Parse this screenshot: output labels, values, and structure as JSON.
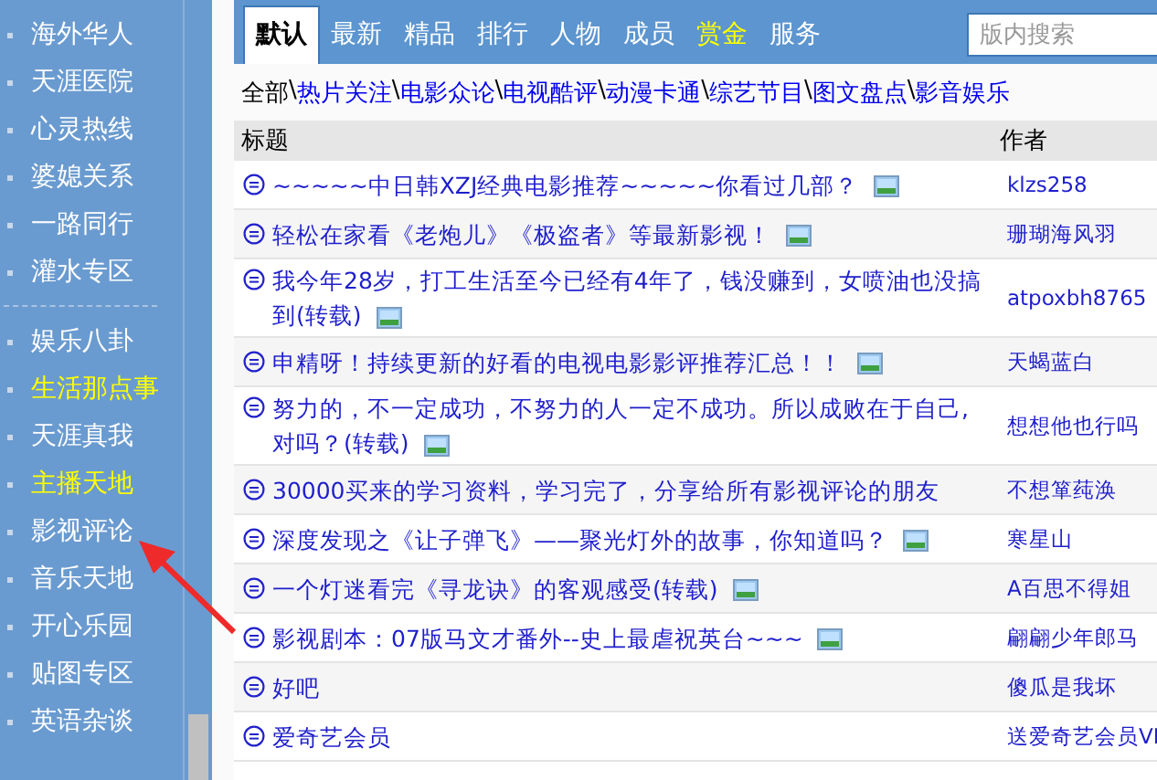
{
  "sidebar": {
    "groups": [
      {
        "items": [
          {
            "label": "海外华人",
            "highlighted": false
          },
          {
            "label": "天涯医院",
            "highlighted": false
          },
          {
            "label": "心灵热线",
            "highlighted": false
          },
          {
            "label": "婆媳关系",
            "highlighted": false
          },
          {
            "label": "一路同行",
            "highlighted": false
          },
          {
            "label": "灌水专区",
            "highlighted": false
          }
        ]
      },
      {
        "items": [
          {
            "label": "娱乐八卦",
            "highlighted": false
          },
          {
            "label": "生活那点事",
            "highlighted": true
          },
          {
            "label": "天涯真我",
            "highlighted": false
          },
          {
            "label": "主播天地",
            "highlighted": true
          },
          {
            "label": "影视评论",
            "highlighted": false
          },
          {
            "label": "音乐天地",
            "highlighted": false
          },
          {
            "label": "开心乐园",
            "highlighted": false
          },
          {
            "label": "贴图专区",
            "highlighted": false
          },
          {
            "label": "英语杂谈",
            "highlighted": false
          }
        ]
      }
    ]
  },
  "tabs": [
    {
      "label": "默认",
      "selected": true,
      "highlighted": false
    },
    {
      "label": "最新",
      "selected": false,
      "highlighted": false
    },
    {
      "label": "精品",
      "selected": false,
      "highlighted": false
    },
    {
      "label": "排行",
      "selected": false,
      "highlighted": false
    },
    {
      "label": "人物",
      "selected": false,
      "highlighted": false
    },
    {
      "label": "成员",
      "selected": false,
      "highlighted": false
    },
    {
      "label": "赏金",
      "selected": false,
      "highlighted": true
    },
    {
      "label": "服务",
      "selected": false,
      "highlighted": false
    }
  ],
  "search": {
    "placeholder": "版内搜索"
  },
  "categories": {
    "current": "全部",
    "separator": "\\",
    "links": [
      "热片关注",
      "电影众论",
      "电视酷评",
      "动漫卡通",
      "综艺节目",
      "图文盘点",
      "影音娱乐"
    ]
  },
  "table": {
    "columns": [
      "标题",
      "作者"
    ],
    "rows": [
      {
        "title": "~~~~~中日韩XZJ经典电影推荐~~~~~你看过几部？",
        "has_image": true,
        "author": "klzs258"
      },
      {
        "title": "轻松在家看《老炮儿》《极盗者》等最新影视！",
        "has_image": true,
        "author": "珊瑚海风羽"
      },
      {
        "title": "我今年28岁，打工生活至今已经有4年了，钱没赚到，女喷油也没搞到(转载)",
        "has_image": true,
        "author": "atpoxbh8765"
      },
      {
        "title": "申精呀！持续更新的好看的电视电影影评推荐汇总！！",
        "has_image": true,
        "author": "天蝎蓝白"
      },
      {
        "title": "努力的，不一定成功，不努力的人一定不成功。所以成败在于自己,对吗？(转载)",
        "has_image": true,
        "author": "想想他也行吗"
      },
      {
        "title": "30000买来的学习资料，学习完了，分享给所有影视评论的朋友",
        "has_image": false,
        "author": "不想箪莼涣"
      },
      {
        "title": "深度发现之《让子弹飞》——聚光灯外的故事，你知道吗？",
        "has_image": true,
        "author": "寒星山"
      },
      {
        "title": "一个灯迷看完《寻龙诀》的客观感受(转载)",
        "has_image": true,
        "author": "A百思不得姐"
      },
      {
        "title": "影视剧本：07版马文才番外--史上最虐祝英台~~~",
        "has_image": true,
        "author": "翩翩少年郎马"
      },
      {
        "title": "好吧",
        "has_image": false,
        "author": "傻瓜是我坏"
      },
      {
        "title": "爱奇艺会员",
        "has_image": false,
        "author": "送爱奇艺会员VI"
      }
    ]
  }
}
